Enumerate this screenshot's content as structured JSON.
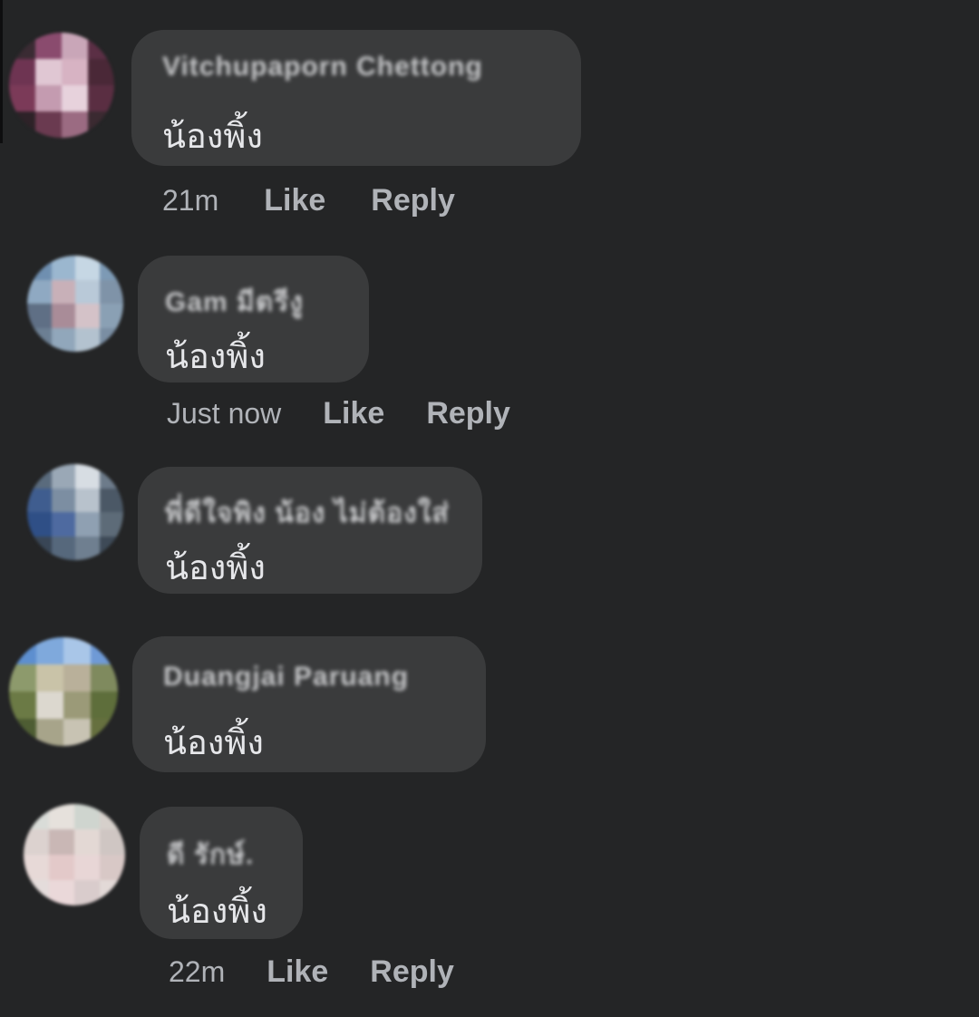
{
  "comments": [
    {
      "author": "Vitchupaporn Chettong",
      "text": "น้องพิ้ง",
      "time": "21m",
      "like_label": "Like",
      "reply_label": "Reply",
      "avatar_colors": [
        "#3a2b33",
        "#8a4b6e",
        "#c9a6b8",
        "#5b2f45",
        "#6e3452",
        "#e0c7d3",
        "#d7b3c3",
        "#4a2837",
        "#7b3a58",
        "#c49bb0",
        "#e7d2dc",
        "#5a2e42",
        "#2e2228",
        "#6a3a50",
        "#9b6b82",
        "#3b2a31"
      ]
    },
    {
      "author": "Gam มีตรีงู",
      "text": "น้องพิ้ง",
      "time": "Just now",
      "like_label": "Like",
      "reply_label": "Reply",
      "avatar_colors": [
        "#6f8fb0",
        "#9bb7cf",
        "#c6d7e4",
        "#7d9ab5",
        "#8fa9c2",
        "#c8b0b8",
        "#b9c9d8",
        "#7f93a8",
        "#5f6f85",
        "#a98c98",
        "#d4c2c8",
        "#8aa0b4",
        "#6c7f93",
        "#91a7bb",
        "#b3c2cf",
        "#7a8ea3"
      ]
    },
    {
      "author": "พี่ดีใจพิง น้อง ไม่ต้องใส่",
      "text": "น้องพิ้ง",
      "time": "",
      "like_label": "",
      "reply_label": "",
      "avatar_colors": [
        "#5a6b7d",
        "#9aa8b6",
        "#d7dde3",
        "#6d7b8a",
        "#3f5d8f",
        "#7c8ea2",
        "#b8c2cc",
        "#4b5866",
        "#2f4f86",
        "#4e6aa0",
        "#8fa0b2",
        "#5d6b78",
        "#394656",
        "#56687c",
        "#6f7f90",
        "#3e4a57"
      ]
    },
    {
      "author": "Duangjai Paruang",
      "text": "น้องพิ้ง",
      "time": "",
      "like_label": "",
      "reply_label": "",
      "avatar_colors": [
        "#5d8fcf",
        "#7fa9dc",
        "#a9c6e8",
        "#6f9ad6",
        "#8d9a6c",
        "#c9c3a8",
        "#b9b09a",
        "#7f8a5e",
        "#6b7a45",
        "#dcd8cf",
        "#9b9a78",
        "#5e6e3b",
        "#4e5d33",
        "#a7a48a",
        "#c8c3b3",
        "#66703f"
      ]
    },
    {
      "author": "ดี รักษ์.",
      "text": "น้องพิ้ง",
      "time": "22m",
      "like_label": "Like",
      "reply_label": "Reply",
      "avatar_colors": [
        "#d9dcd8",
        "#e6e1dc",
        "#cfd5cf",
        "#d6d0cb",
        "#dcd2cf",
        "#c9b7b5",
        "#e3d8d4",
        "#cfc6c3",
        "#e7d9d7",
        "#e3c9c9",
        "#e8d6d6",
        "#d8c8c6",
        "#e4dcdb",
        "#ead8d9",
        "#d9cccc",
        "#e2d9d7"
      ]
    }
  ]
}
